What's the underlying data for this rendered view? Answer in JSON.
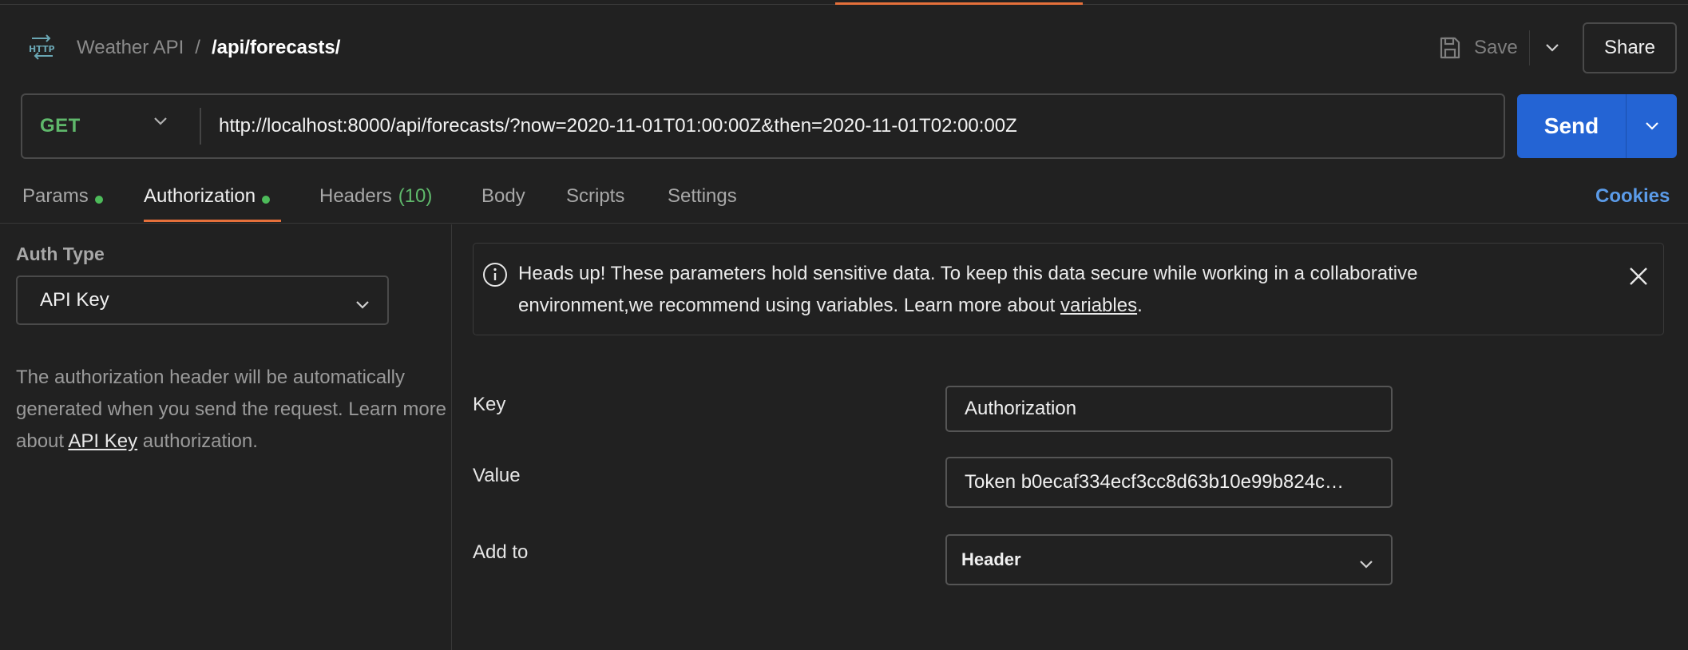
{
  "header": {
    "collection": "Weather API",
    "separator": "/",
    "request_name": "/api/forecasts/",
    "save_label": "Save",
    "share_label": "Share"
  },
  "request": {
    "method": "GET",
    "url": "http://localhost:8000/api/forecasts/?now=2020-11-01T01:00:00Z&then=2020-11-01T02:00:00Z",
    "send_label": "Send"
  },
  "tabs": [
    {
      "label": "Params",
      "dot": true
    },
    {
      "label": "Authorization",
      "dot": true,
      "active": true
    },
    {
      "label": "Headers",
      "count": "(10)"
    },
    {
      "label": "Body"
    },
    {
      "label": "Scripts"
    },
    {
      "label": "Settings"
    }
  ],
  "cookies_label": "Cookies",
  "auth": {
    "type_label": "Auth Type",
    "type_value": "API Key",
    "desc_prefix": "The authorization header will be automatically generated when you send the request. Learn more about ",
    "desc_link": "API Key",
    "desc_suffix": " authorization."
  },
  "notice": {
    "text": "Heads up! These parameters hold sensitive data. To keep this data secure while working in a collaborative environment,we recommend using variables. Learn more about ",
    "link": "variables",
    "end": "."
  },
  "fields": {
    "key_label": "Key",
    "key_value": "Authorization",
    "value_label": "Value",
    "value_value": "Token b0ecaf334ecf3cc8d63b10e99b824c…",
    "add_to_label": "Add to",
    "add_to_value": "Header"
  },
  "colors": {
    "accent": "#e5703b",
    "primary": "#2464d4",
    "method_get": "#5fb86b",
    "dot": "#4dbb5a",
    "link": "#5b9be8"
  },
  "icons": [
    "http-icon",
    "save-icon",
    "chevron-down-icon",
    "info-icon",
    "close-icon"
  ]
}
